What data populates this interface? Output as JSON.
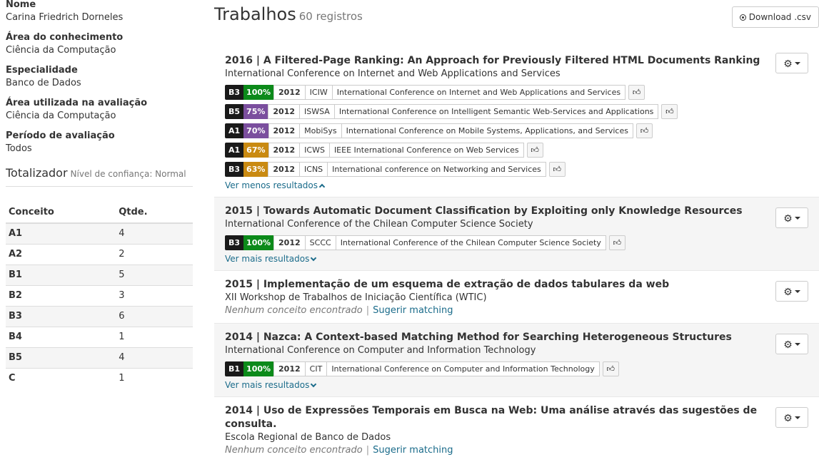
{
  "sidebar": {
    "fields": [
      {
        "label": "Nome",
        "value": "Carina Friedrich Dorneles"
      },
      {
        "label": "Área do conhecimento",
        "value": "Ciência da Computação"
      },
      {
        "label": "Especialidade",
        "value": "Banco de Dados"
      },
      {
        "label": "Área utilizada na avaliação",
        "value": "Ciência da Computação"
      },
      {
        "label": "Período de avaliação",
        "value": "Todos"
      }
    ],
    "totalizer": {
      "title": "Totalizador",
      "subtitle": "Nível de confiança: Normal",
      "col_concept": "Conceito",
      "col_qty": "Qtde.",
      "rows": [
        {
          "concept": "A1",
          "qty": "4"
        },
        {
          "concept": "A2",
          "qty": "2"
        },
        {
          "concept": "B1",
          "qty": "5"
        },
        {
          "concept": "B2",
          "qty": "3"
        },
        {
          "concept": "B3",
          "qty": "6"
        },
        {
          "concept": "B4",
          "qty": "1"
        },
        {
          "concept": "B5",
          "qty": "4"
        },
        {
          "concept": "C",
          "qty": "1"
        }
      ]
    }
  },
  "header": {
    "title": "Trabalhos",
    "count": "60 registros",
    "download_label": "Download .csv"
  },
  "colors": {
    "pct_100": "#0c8a1a",
    "pct_75": "#7b4f9e",
    "pct_70": "#7b4f9e",
    "pct_67": "#c98a12",
    "pct_63": "#c98a12",
    "link": "#1a6b8a"
  },
  "works": [
    {
      "title": "2016 | A Filtered-Page Ranking: An Approach for Previously Filtered HTML Documents Ranking",
      "venue": "International Conference on Internet and Web Applications and Services",
      "shaded": false,
      "matches": [
        {
          "concept": "B3",
          "pct": "100%",
          "color": "#0c8a1a",
          "year": "2012",
          "acronym": "ICIW",
          "name": "International Conference on Internet and Web Applications and Services"
        },
        {
          "concept": "B5",
          "pct": "75%",
          "color": "#7b4f9e",
          "year": "2012",
          "acronym": "ISWSA",
          "name": "International Conference on Intelligent Semantic Web-Services and Applications"
        },
        {
          "concept": "A1",
          "pct": "70%",
          "color": "#7b4f9e",
          "year": "2012",
          "acronym": "MobiSys",
          "name": "International Conference on Mobile Systems, Applications, and Services"
        },
        {
          "concept": "A1",
          "pct": "67%",
          "color": "#c98a12",
          "year": "2012",
          "acronym": "ICWS",
          "name": "IEEE International Conference on Web Services"
        },
        {
          "concept": "B3",
          "pct": "63%",
          "color": "#c98a12",
          "year": "2012",
          "acronym": "ICNS",
          "name": "International conference on Networking and Services"
        }
      ],
      "more_label": "Ver menos resultados",
      "more_dir": "up"
    },
    {
      "title": "2015 | Towards Automatic Document Classification by Exploiting only Knowledge Resources",
      "venue": "International Conference of the Chilean Computer Science Society",
      "shaded": true,
      "matches": [
        {
          "concept": "B3",
          "pct": "100%",
          "color": "#0c8a1a",
          "year": "2012",
          "acronym": "SCCC",
          "name": "International Conference of the Chilean Computer Science Society"
        }
      ],
      "more_label": "Ver mais resultados",
      "more_dir": "down"
    },
    {
      "title": "2015 | Implementação de um esquema de extração de dados tabulares da web",
      "venue": "XII Workshop de Trabalhos de Iniciação Científica (WTIC)",
      "shaded": false,
      "no_concept": "Nenhum conceito encontrado",
      "suggest": "Sugerir matching"
    },
    {
      "title": "2014 | Nazca: A Context-based Matching Method for Searching Heterogeneous Structures",
      "venue": "International Conference on Computer and Information Technology",
      "shaded": true,
      "matches": [
        {
          "concept": "B1",
          "pct": "100%",
          "color": "#0c8a1a",
          "year": "2012",
          "acronym": "CIT",
          "name": "International Conference on Computer and Information Technology"
        }
      ],
      "more_label": "Ver mais resultados",
      "more_dir": "down"
    },
    {
      "title": "2014 | Uso de Expressões Temporais em Busca na Web: Uma análise através das sugestões de consulta.",
      "venue": "Escola Regional de Banco de Dados",
      "shaded": false,
      "no_concept": "Nenhum conceito encontrado",
      "suggest": "Sugerir matching"
    }
  ]
}
